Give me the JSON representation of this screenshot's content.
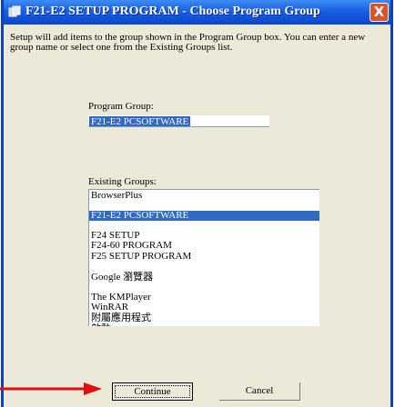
{
  "window": {
    "title": "F21-E2 SETUP PROGRAM - Choose Program Group",
    "close_label": "X"
  },
  "instructions": "Setup will add items to the group shown in the Program Group box. You can enter a new group name or select one from the Existing Groups list.",
  "program_group": {
    "label": "Program Group:",
    "value": "F21-E2 PCSOFTWARE"
  },
  "existing_groups": {
    "label": "Existing Groups:",
    "items": [
      "BrowserPlus",
      "F21-E2 PCSOFTWARE",
      "F24 SETUP",
      "F24-60 PROGRAM",
      "F25 SETUP PROGRAM",
      "Google 瀏覽器",
      "The KMPlayer",
      "WinRAR",
      "附屬應用程式",
      "啟動"
    ],
    "selected_index": 1
  },
  "buttons": {
    "continue": "Continue",
    "cancel": "Cancel"
  },
  "colors": {
    "titlebar": "#0b46d1",
    "selection": "#316ac5",
    "annotation_arrow": "#e01010",
    "close_button": "#d9532c"
  }
}
